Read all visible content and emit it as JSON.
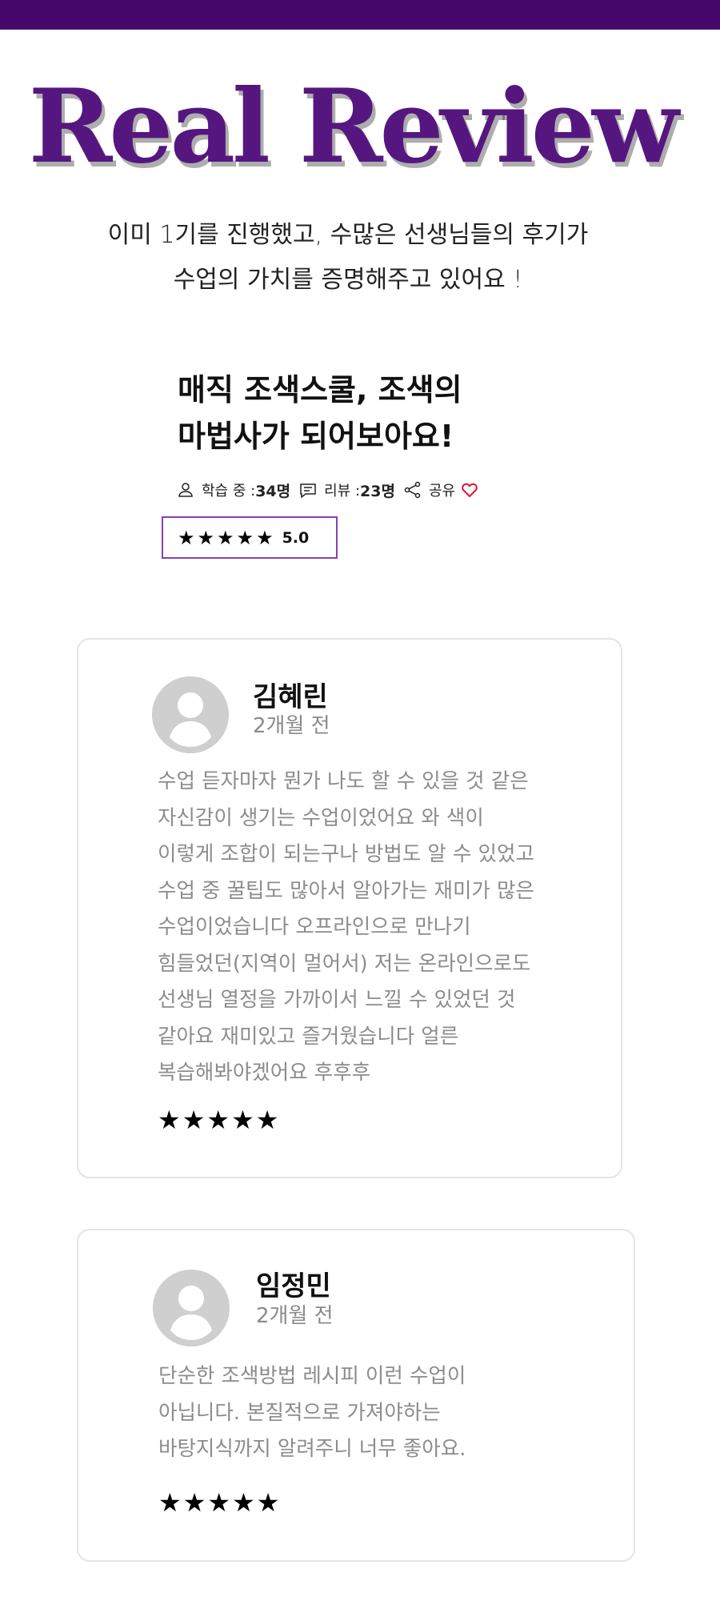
{
  "header": {
    "bar_color": "#46076b"
  },
  "hero": {
    "title": "Real Review",
    "title_color": "#55177f",
    "subtitle_lines": [
      "이미 1기를 진행했고, 수많은 선생님들의 후기가",
      "수업의 가치를 증명해주고 있어요 !"
    ]
  },
  "course": {
    "title_lines": [
      "매직 조색스쿨, 조색의",
      "마법사가 되어보아요!"
    ],
    "learning_label": "학습 중 : ",
    "learning_count": "34명",
    "review_label": "리뷰 : ",
    "review_count": "23명",
    "share_label": "공유",
    "icons": [
      "user-icon",
      "comment-icon",
      "share-icon",
      "heart-icon"
    ],
    "rating_value": "5.0",
    "rating_stars": 5,
    "rating_border_color": "#8a3fb0",
    "heart_color": "#e0142c"
  },
  "reviews": [
    {
      "name": "김혜린",
      "date": "2개월 전",
      "text_lines": [
        "수업 듣자마자 뭔가 나도 할 수 있을 것 같은",
        "자신감이 생기는 수업이었어요 와 색이",
        "이렇게 조합이 되는구나 방법도 알 수 있었고",
        "수업 중 꿀팁도 많아서 알아가는 재미가 많은",
        "수업이었습니다 오프라인으로 만나기",
        "힘들었던(지역이 멀어서) 저는 온라인으로도",
        "선생님 열정을 가까이서 느낄 수 있었던 것",
        "같아요 재미있고 즐거웠습니다 얼른",
        "복습해봐야겠어요 후후후"
      ],
      "rating": 5
    },
    {
      "name": "임정민",
      "date": "2개월 전",
      "text_lines": [
        "단순한 조색방법 레시피 이런 수업이",
        "아닙니다. 본질적으로 가져야하는",
        "바탕지식까지 알려주니 너무 좋아요."
      ],
      "rating": 5
    }
  ]
}
